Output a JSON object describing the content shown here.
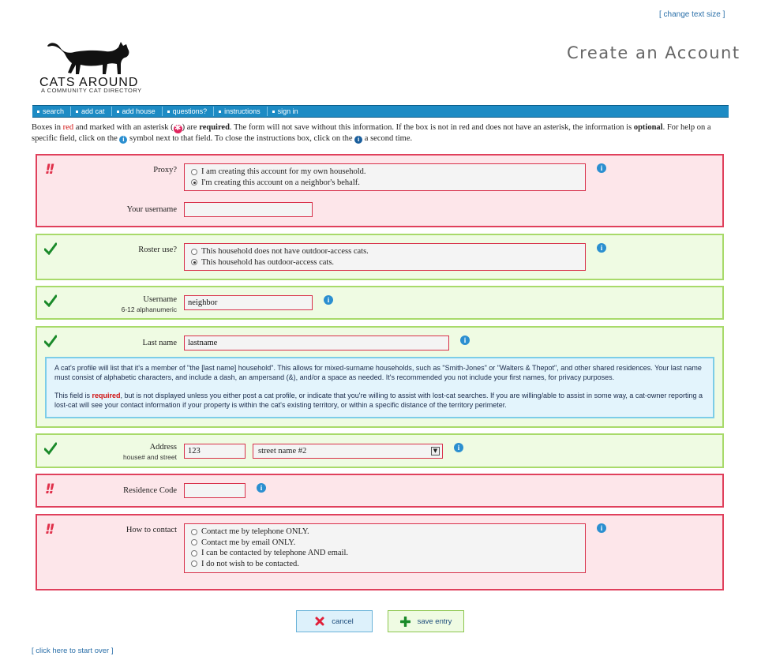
{
  "header": {
    "change_text_size": "[ change text size ]",
    "logo_title": "CATS AROUND",
    "logo_subtitle": "A COMMUNITY CAT DIRECTORY",
    "page_title": "Create an Account"
  },
  "nav": {
    "items": [
      "search",
      "add cat",
      "add house",
      "questions?",
      "instructions",
      "sign in"
    ]
  },
  "instructions": {
    "p1": "Boxes in",
    "red_word": "red",
    "p2": "and marked with an asterisk (",
    "p3": ") are",
    "required_word": "required",
    "p4": ". The form will not save without this information. If the box is not in red and does not have an asterisk, the information is",
    "optional_word": "optional",
    "p5": ". For help on a specific field, click on the",
    "p6": "symbol next to that field. To close the instructions box, click on the",
    "p7": "a second time."
  },
  "form": {
    "proxy": {
      "label": "Proxy?",
      "options": [
        "I am creating this account for my own household.",
        "I'm creating this account on a neighbor's behalf."
      ],
      "selected_index": 1
    },
    "your_username": {
      "label": "Your username",
      "value": ""
    },
    "roster": {
      "label": "Roster use?",
      "options": [
        "This household does not have outdoor-access cats.",
        "This household has outdoor-access cats."
      ],
      "selected_index": 1
    },
    "username": {
      "label": "Username",
      "sublabel": "6-12 alphanumeric",
      "value": "neighbor"
    },
    "last_name": {
      "label": "Last name",
      "value": "lastname",
      "help_p1": "A cat's profile will list that it's a member of \"the [last name] household\". This allows for mixed-surname households, such as \"Smith-Jones\" or \"Walters & Thepot\", and other shared residences. Your last name must consist of alphabetic characters, and include a dash, an ampersand (&), and/or a space as needed. It's recommended you not include your first names, for privacy purposes.",
      "help_p2_a": "This field is",
      "help_p2_required": "required",
      "help_p2_b": ", but is not displayed unless you either post a cat profile, or indicate that you're willing to assist with lost-cat searches. If you are willing/able to assist in some way, a cat-owner reporting a lost-cat will see your contact information if your property is within the cat's existing territory, or within a specific distance of the territory perimeter."
    },
    "address": {
      "label": "Address",
      "sublabel": "house# and street",
      "house_value": "123",
      "street_value": "street name #2"
    },
    "residence_code": {
      "label": "Residence Code",
      "value": ""
    },
    "contact": {
      "label": "How to contact",
      "options": [
        "Contact me by telephone ONLY.",
        "Contact me by email ONLY.",
        "I can be contacted by telephone AND email.",
        "I do not wish to be contacted."
      ],
      "selected_index": -1
    }
  },
  "buttons": {
    "cancel": "cancel",
    "save": "save entry"
  },
  "footer": {
    "start_over": "[ click here to start over ]"
  },
  "colors": {
    "required_border": "#e0405c",
    "required_bg": "#fde6ea",
    "ok_border": "#a8da6a",
    "ok_bg": "#effbe3",
    "nav_bg": "#1d8bc4"
  }
}
